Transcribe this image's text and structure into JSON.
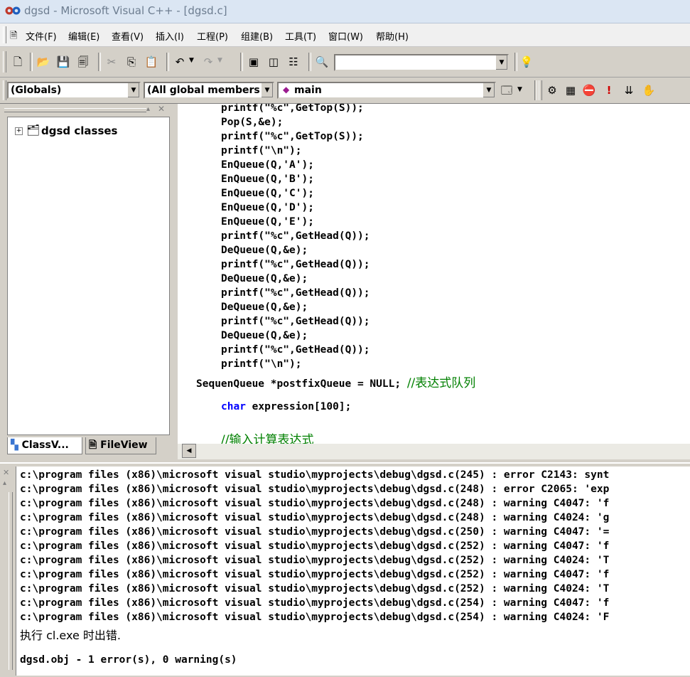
{
  "window": {
    "title": "dgsd - Microsoft Visual C++ - [dgsd.c]"
  },
  "menu": {
    "items": [
      "文件(F)",
      "编辑(E)",
      "查看(V)",
      "插入(I)",
      "工程(P)",
      "组建(B)",
      "工具(T)",
      "窗口(W)",
      "帮助(H)"
    ]
  },
  "toolbar": {
    "find_value": ""
  },
  "wizardbar": {
    "class_combo": "(Globals)",
    "members_combo": "(All global members",
    "function_combo": "main"
  },
  "workspace": {
    "tree_root": "dgsd classes",
    "tabs": [
      "ClassV...",
      "FileView"
    ]
  },
  "editor": {
    "lines": [
      {
        "indent": 4,
        "text": "printf(\"%c\",GetTop(S));"
      },
      {
        "indent": 4,
        "text": "Pop(S,&e);"
      },
      {
        "indent": 4,
        "text": "printf(\"%c\",GetTop(S));"
      },
      {
        "indent": 4,
        "text": "printf(\"\\n\");"
      },
      {
        "indent": 4,
        "text": "EnQueue(Q,'A');"
      },
      {
        "indent": 4,
        "text": "EnQueue(Q,'B');"
      },
      {
        "indent": 4,
        "text": "EnQueue(Q,'C');"
      },
      {
        "indent": 4,
        "text": "EnQueue(Q,'D');"
      },
      {
        "indent": 4,
        "text": "EnQueue(Q,'E');"
      },
      {
        "indent": 4,
        "text": "printf(\"%c\",GetHead(Q));"
      },
      {
        "indent": 4,
        "text": "DeQueue(Q,&e);"
      },
      {
        "indent": 4,
        "text": "printf(\"%c\",GetHead(Q));"
      },
      {
        "indent": 4,
        "text": "DeQueue(Q,&e);"
      },
      {
        "indent": 4,
        "text": "printf(\"%c\",GetHead(Q));"
      },
      {
        "indent": 4,
        "text": "DeQueue(Q,&e);"
      },
      {
        "indent": 4,
        "text": "printf(\"%c\",GetHead(Q));"
      },
      {
        "indent": 4,
        "text": "DeQueue(Q,&e);"
      },
      {
        "indent": 4,
        "text": "printf(\"%c\",GetHead(Q));"
      },
      {
        "indent": 4,
        "text": "printf(\"\\n\");"
      },
      {
        "indent": 0,
        "text": "SequenQueue *postfixQueue = NULL; ",
        "comment": "//表达式队列"
      },
      {
        "indent": 0,
        "text": ""
      },
      {
        "indent": 4,
        "keyword": "char",
        "text": " expression[100];"
      },
      {
        "indent": 0,
        "text": ""
      },
      {
        "indent": 4,
        "text": "",
        "comment": "//输入计算表达式"
      }
    ]
  },
  "output": {
    "lines": [
      "c:\\program files (x86)\\microsoft visual studio\\myprojects\\debug\\dgsd.c(245) : error C2143: synt",
      "c:\\program files (x86)\\microsoft visual studio\\myprojects\\debug\\dgsd.c(248) : error C2065: 'exp",
      "c:\\program files (x86)\\microsoft visual studio\\myprojects\\debug\\dgsd.c(248) : warning C4047: 'f",
      "c:\\program files (x86)\\microsoft visual studio\\myprojects\\debug\\dgsd.c(248) : warning C4024: 'g",
      "c:\\program files (x86)\\microsoft visual studio\\myprojects\\debug\\dgsd.c(250) : warning C4047: '=",
      "c:\\program files (x86)\\microsoft visual studio\\myprojects\\debug\\dgsd.c(252) : warning C4047: 'f",
      "c:\\program files (x86)\\microsoft visual studio\\myprojects\\debug\\dgsd.c(252) : warning C4024: 'T",
      "c:\\program files (x86)\\microsoft visual studio\\myprojects\\debug\\dgsd.c(252) : warning C4047: 'f",
      "c:\\program files (x86)\\microsoft visual studio\\myprojects\\debug\\dgsd.c(252) : warning C4024: 'T",
      "c:\\program files (x86)\\microsoft visual studio\\myprojects\\debug\\dgsd.c(254) : warning C4047: 'f",
      "c:\\program files (x86)\\microsoft visual studio\\myprojects\\debug\\dgsd.c(254) : warning C4024: 'F",
      "执行 cl.exe 时出错.",
      "",
      "dgsd.obj - 1 error(s), 0 warning(s)"
    ]
  }
}
